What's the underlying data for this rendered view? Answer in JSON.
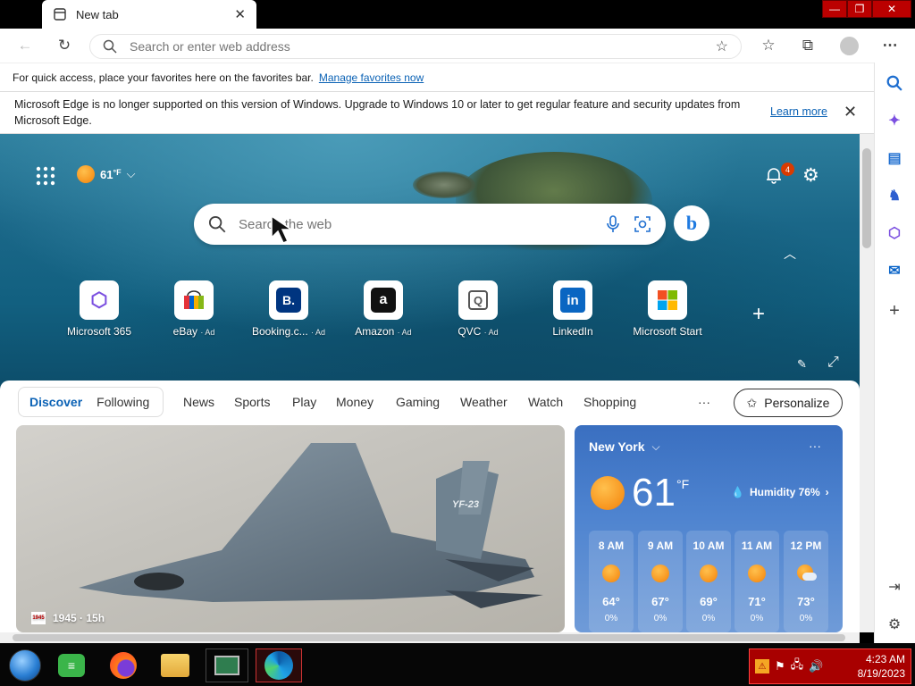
{
  "browser": {
    "tab_title": "New tab",
    "address_placeholder": "Search or enter web address",
    "favbar_text": "For quick access, place your favorites here on the favorites bar.",
    "favbar_link": "Manage favorites now",
    "notice_text": "Microsoft Edge is no longer supported on this version of Windows. Upgrade to Windows 10 or later to get regular feature and security updates from Microsoft Edge.",
    "notice_link": "Learn more"
  },
  "hero": {
    "temperature": "61",
    "temp_unit": "°F",
    "notification_count": "4",
    "search_placeholder": "Search the web"
  },
  "quick_links": [
    {
      "label": "Microsoft 365",
      "ad": ""
    },
    {
      "label": "eBay",
      "ad": "· Ad"
    },
    {
      "label": "Booking.c...",
      "ad": "· Ad"
    },
    {
      "label": "Amazon",
      "ad": "· Ad"
    },
    {
      "label": "QVC",
      "ad": "· Ad"
    },
    {
      "label": "LinkedIn",
      "ad": ""
    },
    {
      "label": "Microsoft Start",
      "ad": ""
    }
  ],
  "feed": {
    "pivots": [
      "Discover",
      "Following"
    ],
    "nav": [
      "News",
      "Sports",
      "Play",
      "Money",
      "Gaming",
      "Weather",
      "Watch",
      "Shopping"
    ],
    "more": "···",
    "personalize": "Personalize",
    "news_source": "1945 · 15h",
    "news_logo": "1945",
    "jet_tail": "YF-23"
  },
  "weather": {
    "city": "New York",
    "temp": "61",
    "unit": "°F",
    "humidity": "Humidity 76%",
    "menu": "···",
    "hours": [
      {
        "time": "8 AM",
        "temp": "64°",
        "precip": "0%"
      },
      {
        "time": "9 AM",
        "temp": "67°",
        "precip": "0%"
      },
      {
        "time": "10 AM",
        "temp": "69°",
        "precip": "0%"
      },
      {
        "time": "11 AM",
        "temp": "71°",
        "precip": "0%"
      },
      {
        "time": "12 PM",
        "temp": "73°",
        "precip": "0%"
      }
    ]
  },
  "taskbar": {
    "time": "4:23 AM",
    "date": "8/19/2023"
  },
  "colors": {
    "accent": "#0b62b5",
    "tray": "#a80000",
    "badge": "#d83b01"
  }
}
